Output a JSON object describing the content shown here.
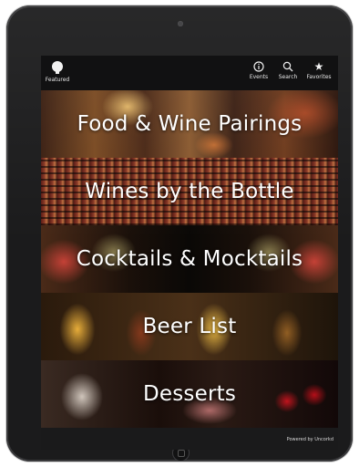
{
  "top_bar": {
    "featured_label": "Featured",
    "nav": [
      {
        "label": "Events",
        "icon": "info-icon"
      },
      {
        "label": "Search",
        "icon": "search-icon"
      },
      {
        "label": "Favorites",
        "icon": "star-icon"
      }
    ]
  },
  "menu": [
    {
      "label": "Food & Wine Pairings"
    },
    {
      "label": "Wines by the Bottle"
    },
    {
      "label": "Cocktails & Mocktails"
    },
    {
      "label": "Beer List"
    },
    {
      "label": "Desserts"
    }
  ],
  "footer": {
    "powered_by": "Powered by Uncorkd"
  },
  "colors": {
    "text": "#ffffff",
    "bar_bg": "#111112",
    "device_bezel": "#1b1b1c"
  },
  "star_glyph": "★"
}
